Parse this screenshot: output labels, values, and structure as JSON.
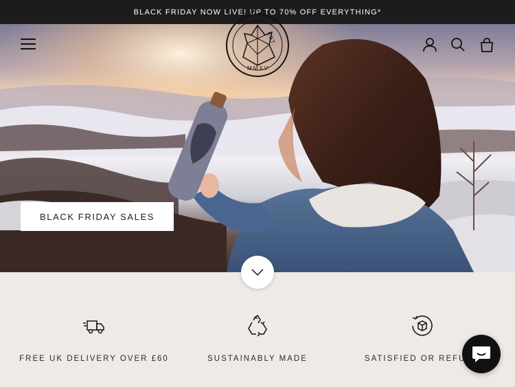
{
  "announcement": {
    "text": "BLACK FRIDAY NOW LIVE! UP TO 70% OFF EVERYTHING*"
  },
  "header": {
    "logo": {
      "top_text": "ILLUSTRATE",
      "side_text": "EST.",
      "bottom_text": "MMXV"
    },
    "icons": {
      "menu": "hamburger-menu-icon",
      "account": "user-icon",
      "search": "search-icon",
      "cart": "shopping-bag-icon"
    }
  },
  "hero": {
    "cta_label": "BLACK FRIDAY SALES",
    "scroll_icon": "chevron-down-icon"
  },
  "features": [
    {
      "label": "FREE UK DELIVERY OVER £60",
      "icon": "delivery-truck-icon"
    },
    {
      "label": "SUSTAINABLY MADE",
      "icon": "recycle-icon"
    },
    {
      "label": "SATISFIED OR REFUND",
      "icon": "return-box-icon"
    }
  ],
  "chat": {
    "icon": "chat-icon"
  },
  "colors": {
    "announcement_bg": "#1c1c1c",
    "features_bg": "#efe9e7",
    "chat_bg": "#111111"
  }
}
